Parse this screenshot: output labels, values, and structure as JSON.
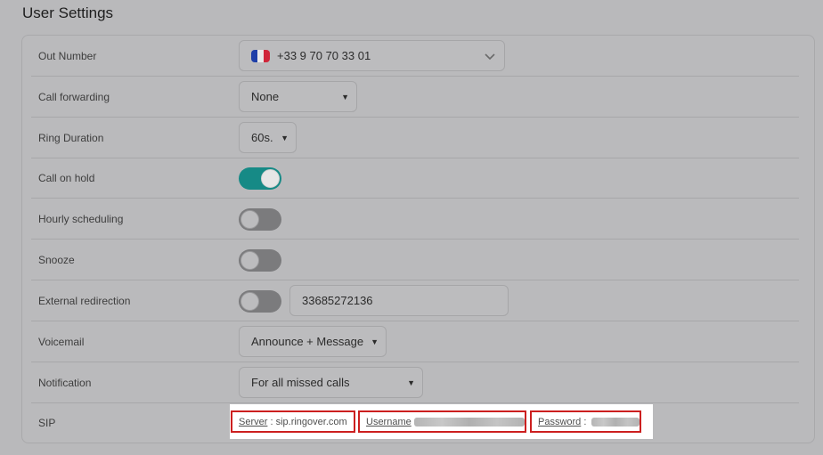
{
  "header": {
    "title": "User Settings"
  },
  "rows": {
    "out_number": {
      "label": "Out Number",
      "value": "+33 9 70 70 33 01",
      "flag": "france-flag-icon"
    },
    "call_forwarding": {
      "label": "Call forwarding",
      "value": "None"
    },
    "ring_duration": {
      "label": "Ring Duration",
      "value": "60s."
    },
    "call_on_hold": {
      "label": "Call on hold",
      "enabled": true
    },
    "hourly_scheduling": {
      "label": "Hourly scheduling",
      "enabled": false
    },
    "snooze": {
      "label": "Snooze",
      "enabled": false
    },
    "external_redirection": {
      "label": "External redirection",
      "enabled": false,
      "number": "33685272136"
    },
    "voicemail": {
      "label": "Voicemail",
      "value": "Announce + Message"
    },
    "notification": {
      "label": "Notification",
      "value": "For all missed calls"
    },
    "sip": {
      "label": "SIP",
      "server_label": "Server",
      "server_sep": " : ",
      "server_value": "sip.ringover.com",
      "username_label": "Username",
      "password_label": "Password",
      "password_sep": " : "
    }
  },
  "colors": {
    "toggle_on": "#168a86",
    "highlight_border": "#cc1f1f"
  }
}
